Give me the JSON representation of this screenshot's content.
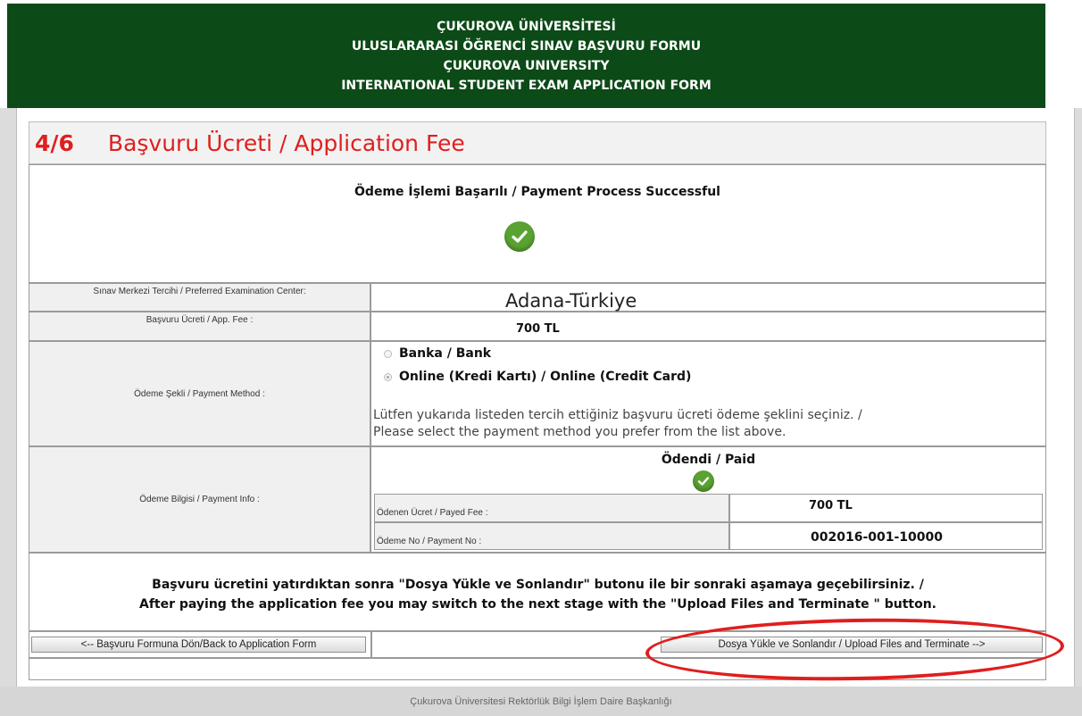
{
  "header": {
    "line1": "ÇUKUROVA ÜNİVERSİTESİ",
    "line2": "ULUSLARARASI ÖĞRENCİ SINAV BAŞVURU FORMU",
    "line3": "ÇUKUROVA UNIVERSITY",
    "line4": "INTERNATIONAL STUDENT EXAM APPLICATION FORM"
  },
  "section": {
    "step": "4/6",
    "title": "Başvuru Ücreti / Application Fee"
  },
  "status": {
    "message": "Ödeme İşlemi Başarılı / Payment Process Successful",
    "icon": "check-circle-icon"
  },
  "form": {
    "exam_center": {
      "label": "Sınav Merkezi Tercihi / Preferred Examination Center:",
      "value": "Adana-Türkiye"
    },
    "app_fee": {
      "label": "Başvuru Ücreti / App. Fee :",
      "value": "700 TL"
    },
    "payment_method": {
      "label": "Ödeme Şekli / Payment Method :",
      "options": [
        "Banka / Bank",
        "Online (Kredi Kartı) / Online (Credit Card)"
      ],
      "selected": "Online (Kredi Kartı) / Online (Credit Card)",
      "note_line1": "Lütfen yukarıda listeden tercih ettiğiniz başvuru ücreti ödeme şeklini seçiniz. /",
      "note_line2": "Please select the payment method you prefer from the list above."
    },
    "payment_info": {
      "label": "Ödeme Bilgisi / Payment Info :",
      "status": "Ödendi / Paid",
      "paid_fee_label": "Ödenen Ücret / Payed Fee :",
      "paid_fee_value": "700 TL",
      "payment_no_label": "Ödeme No / Payment No :",
      "payment_no_value": "002016-001-10000"
    }
  },
  "instructions": {
    "line1": "Başvuru ücretini yatırdıktan sonra \"Dosya Yükle ve Sonlandır\" butonu ile bir sonraki aşamaya geçebilirsiniz. /",
    "line2": "After paying the application fee you may switch to the next stage with the \"Upload Files and Terminate \" button."
  },
  "buttons": {
    "back": "<-- Başvuru Formuna Dön/Back to Application Form",
    "next": "Dosya Yükle ve Sonlandır / Upload Files and Terminate -->"
  },
  "footer": {
    "text": "Çukurova Üniversitesi Rektörlük Bilgi İşlem Daire Başkanlığı"
  },
  "colors": {
    "header_bg": "#0c4a17",
    "title_red": "#e01e1e",
    "check_green": "#5aa332",
    "highlight_ellipse": "#e01e1e"
  }
}
